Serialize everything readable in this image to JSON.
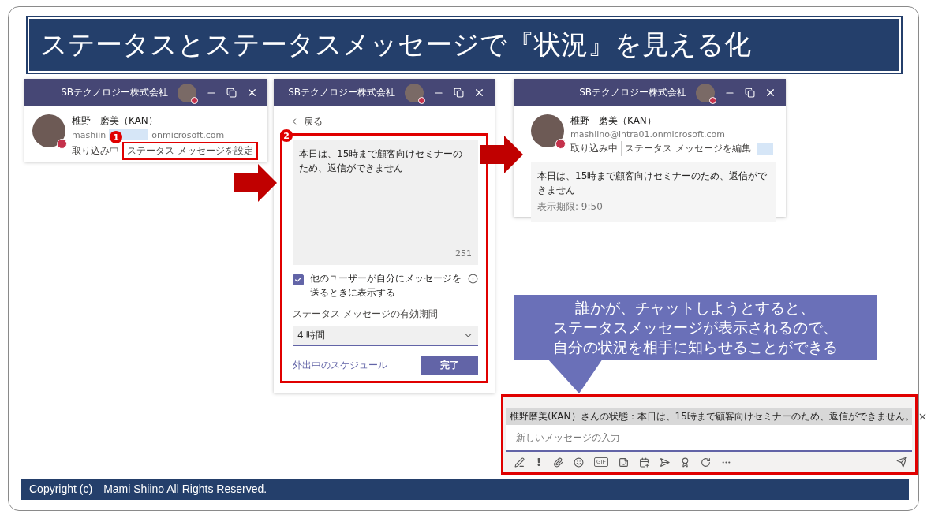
{
  "title": "ステータスとステータスメッセージで『状況』を見える化",
  "window_set_status": {
    "org": "SBテクノロジー株式会社",
    "name": "椎野　磨美（KAN）",
    "email_start": "mashiin",
    "email_end": "onmicrosoft.com",
    "presence": "取り込み中",
    "link": "ステータス メッセージを設定",
    "step": "1"
  },
  "window_edit_status": {
    "org": "SBテクノロジー株式会社",
    "back": "戻る",
    "step": "2",
    "message": "本日は、15時まで顧客向けセミナーのため、返信ができません",
    "counter": "251",
    "show_to_others": {
      "label": "他のユーザーが自分にメッセージを送るときに表示する",
      "checked": true
    },
    "duration_label": "ステータス メッセージの有効期間",
    "duration": "4 時間",
    "schedule_link": "外出中のスケジュール",
    "done": "完了"
  },
  "window_result": {
    "org": "SBテクノロジー株式会社",
    "name": "椎野　磨美（KAN）",
    "email": "mashiino@intra01.onmicrosoft.com",
    "presence": "取り込み中",
    "link": "ステータス メッセージを編集",
    "message": "本日は、15時まで顧客向けセミナーのため、返信ができません",
    "expiry": "表示期限: 9:50"
  },
  "callout": [
    "誰かが、チャットしようとすると、",
    "ステータスメッセージが表示されるので、",
    "自分の状況を相手に知らせることができる"
  ],
  "chat": {
    "banner": "椎野磨美(KAN）さんの状態：本日は、15時まで顧客向けセミナーのため、返信ができません。",
    "placeholder": "新しいメッセージの入力",
    "gif": "GIF"
  },
  "footer": "Copyright (c)　Mami Shiino  All Rights Reserved."
}
